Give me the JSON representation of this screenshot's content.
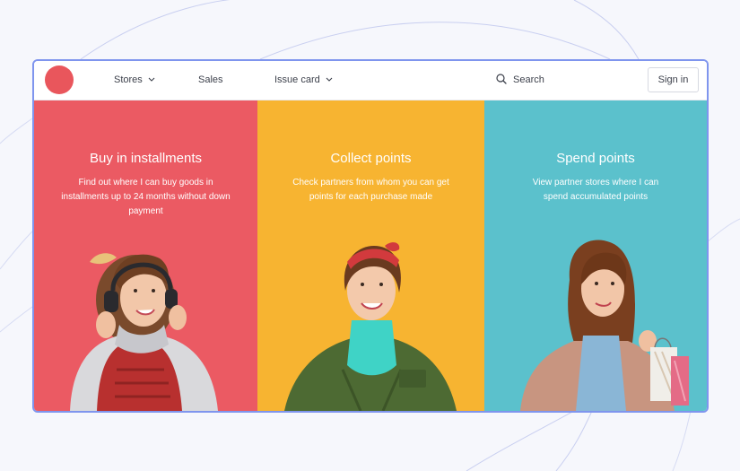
{
  "navbar": {
    "items": [
      {
        "label": "Stores",
        "has_dropdown": true
      },
      {
        "label": "Sales",
        "has_dropdown": false
      },
      {
        "label": "Issue card",
        "has_dropdown": true
      }
    ],
    "search_label": "Search",
    "signin_label": "Sign in",
    "logo_color": "#e9565c"
  },
  "panels": [
    {
      "title": "Buy in installments",
      "description": "Find out where I can buy goods in installments up to 24 months without down payment",
      "color": "#eb5a63"
    },
    {
      "title": "Collect points",
      "description": "Check partners from whom you can get points for each purchase made",
      "color": "#f7b431"
    },
    {
      "title": "Spend points",
      "description": "View partner stores where I can spend accumulated points",
      "color": "#5bc1cc"
    }
  ],
  "colors": {
    "frame_border": "#7f95ee",
    "page_background": "#f6f7fc"
  }
}
